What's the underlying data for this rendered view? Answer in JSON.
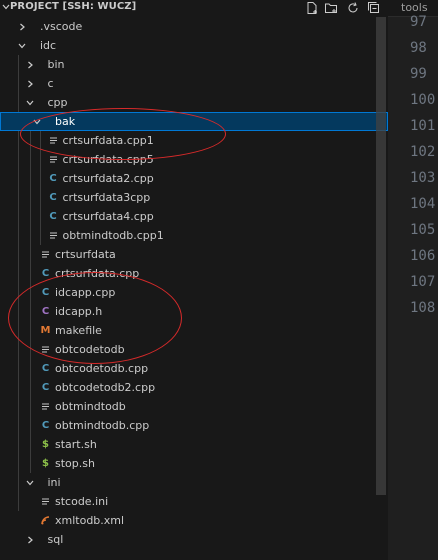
{
  "explorer": {
    "title": "PROJECT [SSH: WUCZ]",
    "header_actions": [
      "new-file-icon",
      "new-folder-icon",
      "refresh-icon",
      "collapse-all-icon"
    ],
    "items": [
      {
        "label": ".vscode",
        "type": "folder",
        "expanded": false
      },
      {
        "label": "idc",
        "type": "folder",
        "expanded": true
      },
      {
        "label": "bin",
        "type": "folder",
        "expanded": false
      },
      {
        "label": "c",
        "type": "folder",
        "expanded": false
      },
      {
        "label": "cpp",
        "type": "folder",
        "expanded": true
      },
      {
        "label": "bak",
        "type": "folder",
        "expanded": true,
        "selected": true
      },
      {
        "label": "crtsurfdata.cpp1",
        "type": "text"
      },
      {
        "label": "crtsurfdata.cpp5",
        "type": "text"
      },
      {
        "label": "crtsurfdata2.cpp",
        "type": "cpp"
      },
      {
        "label": "crtsurfdata3cpp",
        "type": "cpp"
      },
      {
        "label": "crtsurfdata4.cpp",
        "type": "cpp"
      },
      {
        "label": "obtmindtodb.cpp1",
        "type": "text"
      },
      {
        "label": "crtsurfdata",
        "type": "text"
      },
      {
        "label": "crtsurfdata.cpp",
        "type": "cpp"
      },
      {
        "label": "idcapp.cpp",
        "type": "cpp"
      },
      {
        "label": "idcapp.h",
        "type": "header"
      },
      {
        "label": "makefile",
        "type": "makefile"
      },
      {
        "label": "obtcodetodb",
        "type": "text"
      },
      {
        "label": "obtcodetodb.cpp",
        "type": "cpp"
      },
      {
        "label": "obtcodetodb2.cpp",
        "type": "cpp"
      },
      {
        "label": "obtmindtodb",
        "type": "text"
      },
      {
        "label": "obtmindtodb.cpp",
        "type": "cpp"
      },
      {
        "label": "start.sh",
        "type": "shell"
      },
      {
        "label": "stop.sh",
        "type": "shell"
      },
      {
        "label": "ini",
        "type": "folder",
        "expanded": true
      },
      {
        "label": "stcode.ini",
        "type": "text"
      },
      {
        "label": "xmltodb.xml",
        "type": "xml"
      },
      {
        "label": "sql",
        "type": "folder",
        "expanded": false
      }
    ]
  },
  "editor": {
    "tab_label": "tools",
    "line_numbers": [
      "97",
      "98",
      "99",
      "100",
      "101",
      "102",
      "103",
      "104",
      "105",
      "106",
      "107",
      "108"
    ]
  },
  "colors": {
    "cpp_icon": "#519aba",
    "header_icon": "#a074c4",
    "makefile_icon": "#e37933",
    "shell_icon": "#8dc149",
    "xml_icon": "#e37933",
    "selection": "#04395e",
    "annotation": "#d62a2a"
  }
}
